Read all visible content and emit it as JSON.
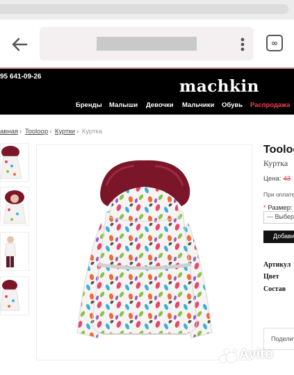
{
  "browser": {
    "back_icon": "arrow-left-icon",
    "menu_icon": "more-vert-icon",
    "tabs_count": "∞"
  },
  "site": {
    "phone": "95 641-09-26",
    "logo": "machkin",
    "nav": [
      "Бренды",
      "Малыши",
      "Девочки",
      "Мальчики",
      "Обувь",
      "Распродажа"
    ],
    "sale_color": "#ff3b5c"
  },
  "breadcrumb": {
    "items": [
      "авная",
      "Tooloop",
      "Куртки"
    ],
    "current": "Куртка",
    "separator": "›"
  },
  "product": {
    "title": "Tooloo",
    "subtitle": "Куртка",
    "price_label": "Цена:",
    "old_price": "43",
    "payment_note": "При оплате",
    "size_label": "Размер:",
    "size_required": "*",
    "size_placeholder": "--- Выбери",
    "add_button": "Добави",
    "specs": [
      "Артикул",
      "Цвет",
      "Состав"
    ],
    "share": "Поделит"
  },
  "watermark": {
    "text": "Avito"
  }
}
